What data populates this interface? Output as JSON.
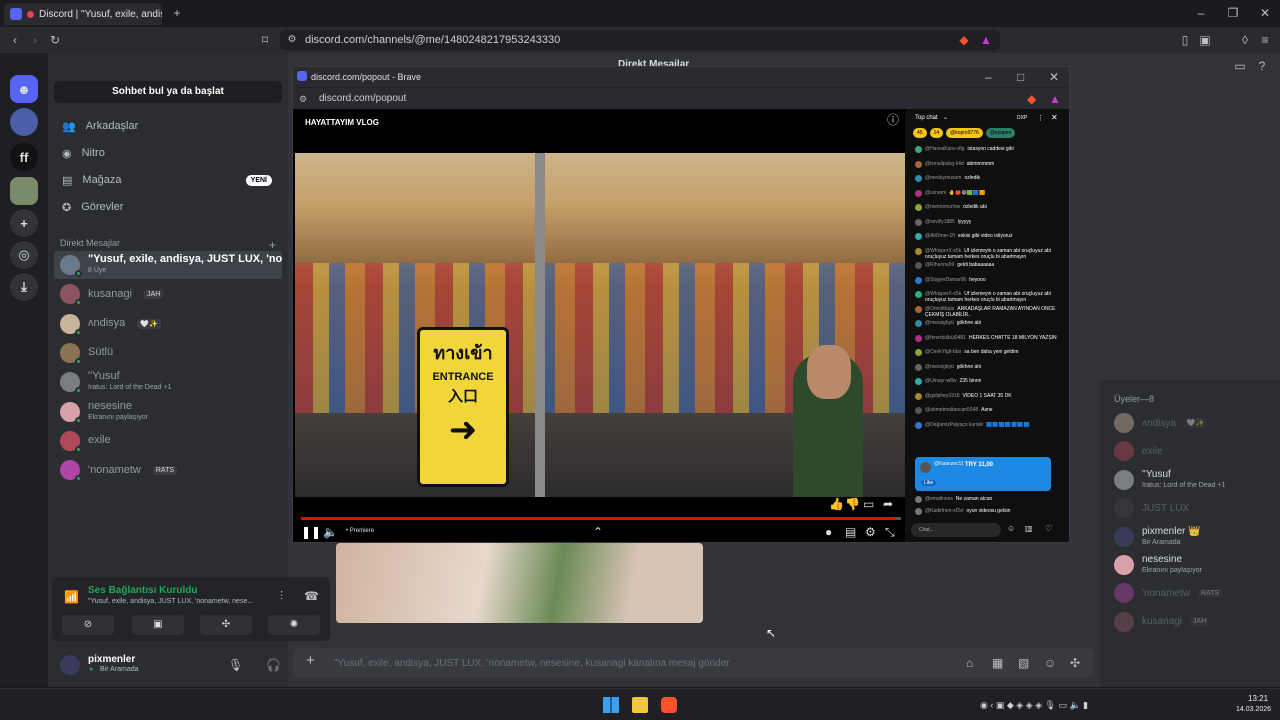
{
  "browser": {
    "tab_title": "Discord | \"Yusuf, exile, andis...",
    "url": "discord.com/channels/@me/1480248217953243330",
    "new_tab": "+"
  },
  "header": {
    "title": "Direkt Mesajlar"
  },
  "sidebar": {
    "search": "Sohbet bul ya da başlat",
    "nav": [
      {
        "label": "Arkadaşlar",
        "icon": "friends-icon"
      },
      {
        "label": "Nitro",
        "icon": "nitro-icon"
      },
      {
        "label": "Mağaza",
        "icon": "shop-icon",
        "badge": "YENİ"
      },
      {
        "label": "Görevler",
        "icon": "quests-icon"
      }
    ],
    "dm_header": "Direkt Mesajlar",
    "dms": [
      {
        "name": "\"Yusuf, exile, andisya, JUST LUX, 'nona...",
        "sub": "8 Üye",
        "color": "#6b7a8a"
      },
      {
        "name": "kusanagi",
        "tag": "JAH",
        "color": "#8a5560"
      },
      {
        "name": "ᴧndisya",
        "tag": "🤍✨",
        "color": "#c8b49a"
      },
      {
        "name": "Sütlü",
        "color": "#8a7350"
      },
      {
        "name": "''Yusuf",
        "sub": "Iratus: Lord of the Dead +1",
        "color": "#7a7d82"
      },
      {
        "name": "nesesine",
        "sub": "Ekranını paylaşıyor",
        "color": "#d8a0a8"
      },
      {
        "name": "exile",
        "color": "#b04a5a"
      },
      {
        "name": "'nonametw",
        "tag": "RATS",
        "color": "#b044a8"
      }
    ]
  },
  "voice": {
    "status": "Ses Bağlantısı Kuruldu",
    "channel": "\"Yusuf, exile, andisya, JUST LUX, 'nonametw, nese..."
  },
  "user": {
    "name": "pixmenler",
    "status": "Bir Aramada"
  },
  "chat": {
    "placeholder": "\"Yusuf, exile, andisya, JUST LUX, 'nonametw, nesesine, kusanagi kanalına mesaj gönder"
  },
  "members": {
    "header": "Üyeler—8",
    "list": [
      {
        "name": "ᴧndisya",
        "tag": "🤍✨",
        "color": "#c8b49a",
        "dim": true
      },
      {
        "name": "exile",
        "color": "#b04a5a",
        "dim": true
      },
      {
        "name": "''Yusuf",
        "sub": "Iratus: Lord of the Dead +1",
        "color": "#7a7d82",
        "dim": false
      },
      {
        "name": "JUST LUX",
        "color": "#444",
        "dim": true
      },
      {
        "name": "pixmenler 👑",
        "sub": "Bir Aramada",
        "color": "#3a3a5a",
        "dim": false
      },
      {
        "name": "nesesine",
        "sub": "Ekranını paylaşıyor",
        "color": "#d8a0a8",
        "dim": false
      },
      {
        "name": "'nonametw",
        "tag": "RATS",
        "color": "#b044a8",
        "dim": true
      },
      {
        "name": "kusanagi",
        "tag": "JAH",
        "color": "#8a5560",
        "dim": true
      }
    ]
  },
  "popout": {
    "title": "discord.com/popout - Brave",
    "url": "discord.com/popout",
    "stream_title": "HAYATTAYIM VLOG",
    "premiere": "• Premiere",
    "progress": 0.99,
    "sign_thai": "ทางเข้า",
    "sign_en": "ENTRANCE",
    "sign_jp": "入口",
    "chat_header": "Top chat",
    "chat_dxp": "DXP",
    "chat_input": "Chat...",
    "chat_pills": [
      "45",
      "14",
      "@kopro9776",
      "@eyaperi"
    ],
    "messages": [
      {
        "u": "@HavvaKara-v8g",
        "t": "istasyon caddesi gibi"
      },
      {
        "u": "@ismailpubg-k4d",
        "t": "abimmmmm"
      },
      {
        "u": "@medoymusum",
        "t": "ozledik"
      },
      {
        "u": "@ssnami",
        "t": "🤚🍎😄🟩🟦🟧"
      },
      {
        "u": "@memomurlow",
        "t": "özledik abi"
      },
      {
        "u": "@sevilly1885",
        "t": "iyyyyy"
      },
      {
        "u": "@AliOmer-l2l",
        "t": "eskisi gibi video istiyoruz"
      },
      {
        "u": "@WhisperX-x5k",
        "t": "Üf izlemeyin o zaman abi oruçluyuz abi oruçluyuz tamam herkes oruçlu bi abartmayın"
      },
      {
        "u": "@Rihanna99",
        "t": "geldi babaaaaaa"
      },
      {
        "u": "@StajyerDamar06",
        "t": "heyooo"
      },
      {
        "u": "@WhisperX-x5k",
        "t": "Üf izlemeyin o zaman abi oruçluyuz abi oruçluyuz tamam herkes oruçlu bi abartmayın"
      },
      {
        "u": "@OmniMaps",
        "t": "ARKADAŞLAR RAMAZAN AYINDAN ÖNCE ÇEKMİŞ OLABİLİR.."
      },
      {
        "u": "@messigbyti",
        "t": "gökhne abi"
      },
      {
        "u": "@fenerbülbül0481",
        "t": "HERKES CHATTE 18 MİLYON YAZSIN"
      },
      {
        "u": "@CenkYigit-bbo",
        "t": "sa ben daha yeni geldim"
      },
      {
        "u": "@messigbyti",
        "t": "gökhne ahi"
      },
      {
        "u": "@Umayr-w8w",
        "t": "235 binnn"
      },
      {
        "u": "@gsilphey3318",
        "t": "VİDEO 1 SAAT 35 DK"
      },
      {
        "u": "@ahmetmaltaocan5548",
        "t": "Asne"
      },
      {
        "u": "@DeğamizPalyaço kursiki",
        "t": "🟦🟦🟦🟦🟦🟦🟦"
      }
    ],
    "superchat": {
      "user": "@Kaanzec11",
      "amount": "TRY 11,00",
      "like": "Like"
    },
    "after": [
      {
        "u": "@emalinnes",
        "t": "Ne zaman atcan"
      },
      {
        "u": "@Kadirfnen-xf3vl",
        "t": "oyun videosu gelsin"
      }
    ]
  },
  "taskbar": {
    "time": "13:21",
    "date": "14.03.2026"
  },
  "colors": {
    "accent": "#5865f2",
    "online": "#23a55a",
    "voice": "#23a55a"
  }
}
